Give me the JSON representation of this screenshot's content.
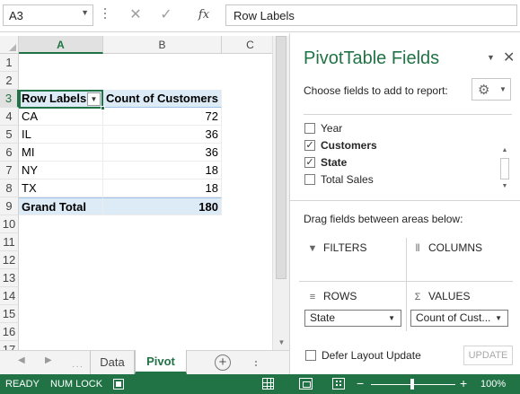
{
  "formula_bar": {
    "name_box": "A3",
    "cancel_icon": "✕",
    "enter_icon": "✓",
    "fx_label": "fx",
    "formula": "Row Labels"
  },
  "grid": {
    "columns": [
      "A",
      "B",
      "C"
    ],
    "rows": [
      "1",
      "2",
      "3",
      "4",
      "5",
      "6",
      "7",
      "8",
      "9",
      "10",
      "11",
      "12",
      "13",
      "14",
      "15",
      "16",
      "17"
    ],
    "pivot_header": {
      "row_labels": "Row Labels",
      "count_header": "Count of Customers"
    },
    "pivot_rows": [
      {
        "state": "CA",
        "count": "72"
      },
      {
        "state": "IL",
        "count": "36"
      },
      {
        "state": "MI",
        "count": "36"
      },
      {
        "state": "NY",
        "count": "18"
      },
      {
        "state": "TX",
        "count": "18"
      }
    ],
    "grand_total": {
      "label": "Grand Total",
      "value": "180"
    }
  },
  "sheet_tabs": {
    "tabs": [
      "Data",
      "Pivot"
    ],
    "active": "Pivot",
    "add_label": "+"
  },
  "pivot_pane": {
    "title": "PivotTable Fields",
    "choose_label": "Choose fields to add to report:",
    "fields": [
      {
        "name": "Year",
        "checked": false
      },
      {
        "name": "Customers",
        "checked": true
      },
      {
        "name": "State",
        "checked": true
      },
      {
        "name": "Total Sales",
        "checked": false
      }
    ],
    "drag_label": "Drag fields between areas below:",
    "areas": {
      "filters": "FILTERS",
      "columns": "COLUMNS",
      "rows": "ROWS",
      "values": "VALUES"
    },
    "rows_field": "State",
    "values_field": "Count of Cust...",
    "defer_label": "Defer Layout Update",
    "update_label": "UPDATE"
  },
  "status_bar": {
    "ready": "READY",
    "num_lock": "NUM LOCK",
    "zoom_minus": "−",
    "zoom_plus": "+",
    "zoom": "100%"
  },
  "colors": {
    "excel_green": "#217346",
    "pivot_header_blue": "#ddebf7"
  }
}
